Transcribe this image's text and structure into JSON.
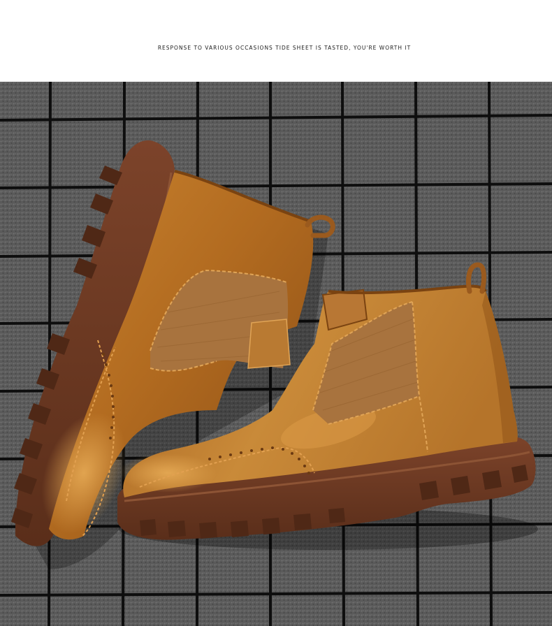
{
  "header": {
    "tagline": "RESPONSE TO VARIOUS OCCASIONS TIDE SHEET IS TASTED, YOU'RE WORTH IT"
  },
  "photo": {
    "subject": "two tan leather chelsea boots with brogue detailing on a black wire grid over grey carpet",
    "colors": {
      "leather": "#b06a22",
      "leather_highlight": "#d9953f",
      "leather_shadow": "#7a4311",
      "elastic": "#a8733e",
      "sole": "#6e3a22",
      "sole_dark": "#4f2816",
      "carpet": "#5c5c5c",
      "grid": "#101010"
    }
  }
}
